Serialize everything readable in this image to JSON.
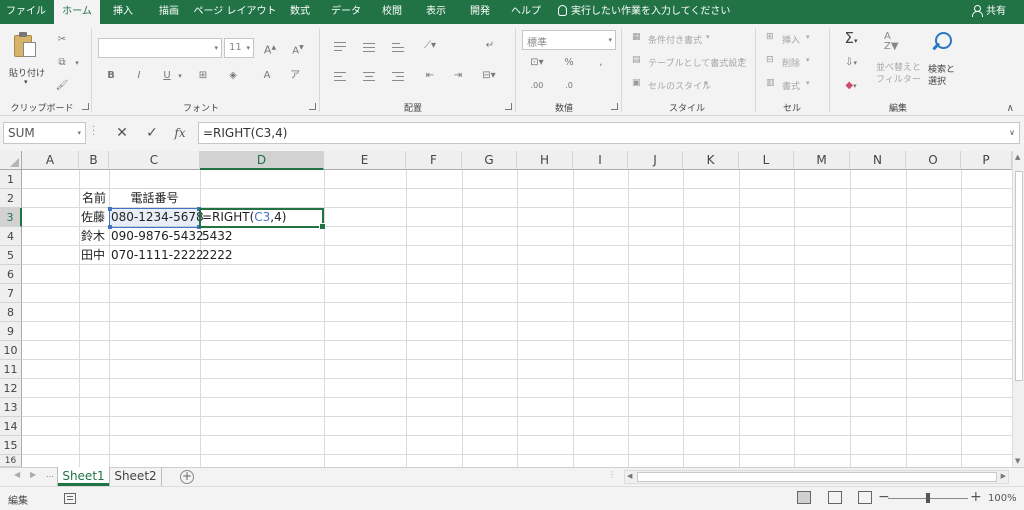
{
  "ribbon_tabs": [
    "ファイル",
    "ホーム",
    "挿入",
    "描画",
    "ページ レイアウト",
    "数式",
    "データ",
    "校閲",
    "表示",
    "開発",
    "ヘルプ"
  ],
  "active_tab": "ホーム",
  "tell_me": "実行したい作業を入力してください",
  "share": "共有",
  "ribbon": {
    "paste": "貼り付け",
    "font_size": "11",
    "number_format": "標準",
    "conditional_format": "条件付き書式",
    "format_as_table": "テーブルとして書式設定",
    "cell_styles": "セルのスタイル",
    "insert": "挿入",
    "delete": "削除",
    "format": "書式",
    "sort_filter_line1": "並べ替えと",
    "sort_filter_line2": "フィルター",
    "find_select_line1": "検索と",
    "find_select_line2": "選択",
    "groups": {
      "clipboard": "クリップボード",
      "font": "フォント",
      "alignment": "配置",
      "number": "数値",
      "styles": "スタイル",
      "cells": "セル",
      "editing": "編集"
    }
  },
  "formula_bar": {
    "name_box": "SUM",
    "cancel": "✕",
    "enter": "✓",
    "fx": "fx",
    "formula": "=RIGHT(C3,4)"
  },
  "columns": [
    "A",
    "B",
    "C",
    "D",
    "E",
    "F",
    "G",
    "H",
    "I",
    "J",
    "K",
    "L",
    "M",
    "N",
    "O",
    "P"
  ],
  "rows": [
    "1",
    "2",
    "3",
    "4",
    "5",
    "6",
    "7",
    "8",
    "9",
    "10",
    "11",
    "12",
    "13",
    "14",
    "15",
    "16"
  ],
  "cells": {
    "B2": "名前",
    "C2": "電話番号",
    "B3": "佐藤",
    "C3": "080-1234-5678",
    "D3_prefix": "=RIGHT(",
    "D3_ref": "C3",
    "D3_suffix": ",4)",
    "B4": "鈴木",
    "C4": "090-9876-5432",
    "D4": "5432",
    "B5": "田中",
    "C5": "070-1111-2222",
    "D5": "2222"
  },
  "colors": {
    "accent": "#217346",
    "ref_blue": "#4472c4"
  },
  "sheets": [
    "Sheet1",
    "Sheet2"
  ],
  "active_sheet": "Sheet1",
  "status": {
    "mode": "編集",
    "zoom": "100%"
  }
}
